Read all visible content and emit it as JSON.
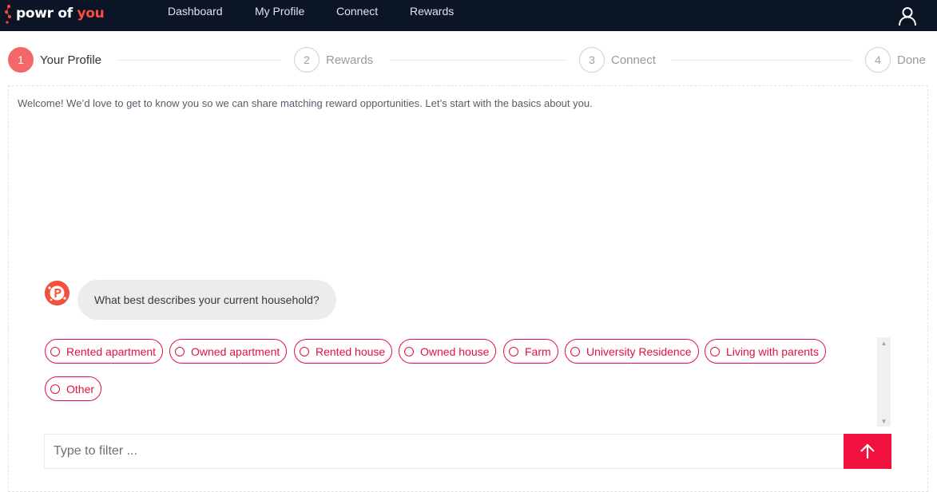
{
  "brand": {
    "logo_prefix": "powr of ",
    "logo_accent": "you",
    "accent_color": "#f0113f",
    "nav_bg": "#0b1526"
  },
  "nav": {
    "links": [
      "Dashboard",
      "My Profile",
      "Connect",
      "Rewards"
    ],
    "user_icon": "user-icon"
  },
  "stepper": {
    "steps": [
      {
        "number": "1",
        "label": "Your Profile",
        "active": true
      },
      {
        "number": "2",
        "label": "Rewards",
        "active": false
      },
      {
        "number": "3",
        "label": "Connect",
        "active": false
      },
      {
        "number": "4",
        "label": "Done",
        "active": false
      }
    ]
  },
  "chat": {
    "welcome": "Welcome! We’d love to get to know you so we can share matching reward opportunities. Let’s start with the basics about you.",
    "question": "What best describes your current household?",
    "bot_icon": "powr-bot-icon",
    "options": [
      "Rented apartment",
      "Owned apartment",
      "Rented house",
      "Owned house",
      "Farm",
      "University Residence",
      "Living with parents",
      "Other"
    ]
  },
  "filter": {
    "placeholder": "Type to filter ...",
    "value": "",
    "send_icon": "arrow-up-icon"
  }
}
